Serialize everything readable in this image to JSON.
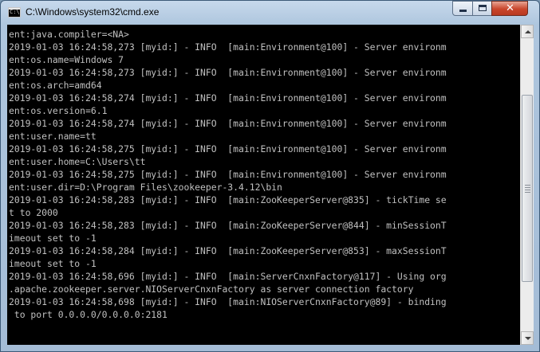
{
  "window": {
    "title": "C:\\Windows\\system32\\cmd.exe",
    "icon": "cmd-icon",
    "icon_text": "C:\\"
  },
  "controls": {
    "minimize": "minimize-icon",
    "maximize": "maximize-icon",
    "close": "close-icon",
    "close_glyph": "✕"
  },
  "console": {
    "lines": [
      "ent:java.compiler=<NA>",
      "2019-01-03 16:24:58,273 [myid:] - INFO  [main:Environment@100] - Server environm",
      "ent:os.name=Windows 7",
      "2019-01-03 16:24:58,273 [myid:] - INFO  [main:Environment@100] - Server environm",
      "ent:os.arch=amd64",
      "2019-01-03 16:24:58,274 [myid:] - INFO  [main:Environment@100] - Server environm",
      "ent:os.version=6.1",
      "2019-01-03 16:24:58,274 [myid:] - INFO  [main:Environment@100] - Server environm",
      "ent:user.name=tt",
      "2019-01-03 16:24:58,275 [myid:] - INFO  [main:Environment@100] - Server environm",
      "ent:user.home=C:\\Users\\tt",
      "2019-01-03 16:24:58,275 [myid:] - INFO  [main:Environment@100] - Server environm",
      "ent:user.dir=D:\\Program Files\\zookeeper-3.4.12\\bin",
      "2019-01-03 16:24:58,283 [myid:] - INFO  [main:ZooKeeperServer@835] - tickTime se",
      "t to 2000",
      "2019-01-03 16:24:58,283 [myid:] - INFO  [main:ZooKeeperServer@844] - minSessionT",
      "imeout set to -1",
      "2019-01-03 16:24:58,284 [myid:] - INFO  [main:ZooKeeperServer@853] - maxSessionT",
      "imeout set to -1",
      "2019-01-03 16:24:58,696 [myid:] - INFO  [main:ServerCnxnFactory@117] - Using org",
      ".apache.zookeeper.server.NIOServerCnxnFactory as server connection factory",
      "2019-01-03 16:24:58,698 [myid:] - INFO  [main:NIOServerCnxnFactory@89] - binding",
      " to port 0.0.0.0/0.0.0.0:2181"
    ]
  },
  "scrollbar": {
    "up_icon": "scroll-up-arrow-icon",
    "down_icon": "scroll-down-arrow-icon",
    "position": 0.6
  }
}
